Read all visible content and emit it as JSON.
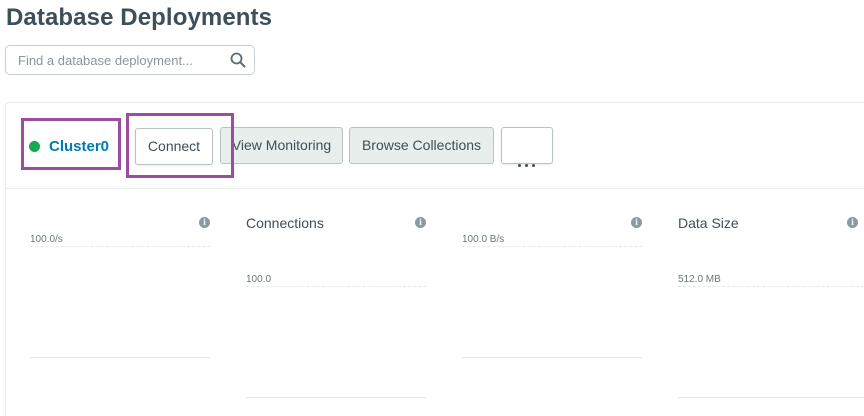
{
  "page": {
    "title": "Database Deployments"
  },
  "search": {
    "placeholder": "Find a database deployment..."
  },
  "cluster": {
    "name": "Cluster0",
    "status_color": "#13aa52",
    "actions": {
      "connect": "Connect",
      "view_monitoring": "View Monitoring",
      "browse_collections": "Browse Collections",
      "more": "more-options"
    }
  },
  "metrics": [
    {
      "title": "",
      "max_label": "100.0/s"
    },
    {
      "title": "Connections",
      "max_label": "100.0"
    },
    {
      "title": "",
      "max_label": "100.0 B/s"
    },
    {
      "title": "Data Size",
      "max_label": "512.0 MB"
    }
  ],
  "colors": {
    "highlight": "#9b4d9f",
    "link": "#007cad",
    "status_running": "#13aa52"
  }
}
